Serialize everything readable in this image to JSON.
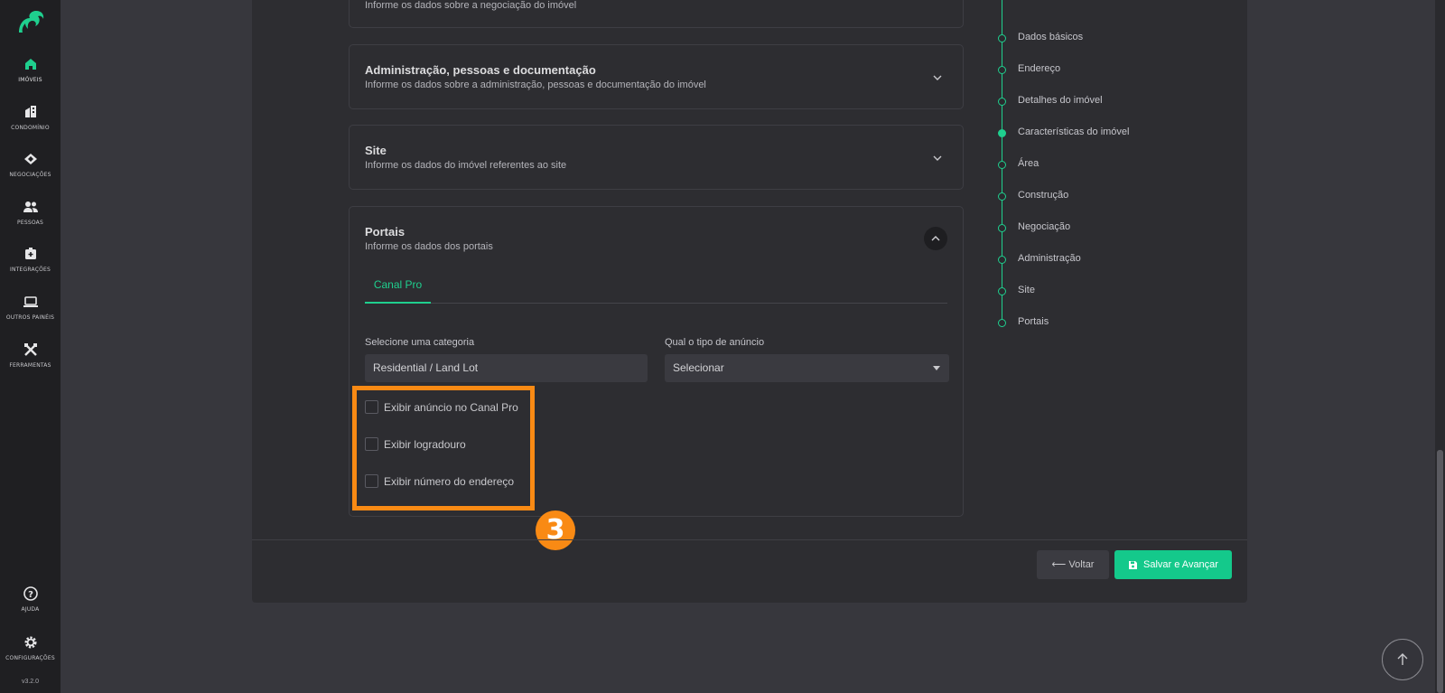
{
  "sidebar": {
    "items": [
      {
        "label": "Imóveis",
        "icon": "home-icon"
      },
      {
        "label": "Condomínio",
        "icon": "building-icon"
      },
      {
        "label": "Negociações",
        "icon": "handshake-icon"
      },
      {
        "label": "Pessoas",
        "icon": "people-icon"
      },
      {
        "label": "Integrações",
        "icon": "integration-icon"
      },
      {
        "label": "Outros painéis",
        "icon": "laptop-icon"
      },
      {
        "label": "Ferramentas",
        "icon": "tools-icon"
      },
      {
        "label": "Ajuda",
        "icon": "help-icon"
      },
      {
        "label": "Configurações",
        "icon": "gear-icon"
      }
    ],
    "version": "v3.2.0"
  },
  "sections": {
    "negociacao_sub": "Informe os dados sobre a negociação do imóvel",
    "administracao": {
      "title": "Administração, pessoas e documentação",
      "subtitle": "Informe os dados sobre a administração, pessoas e documentação do imóvel"
    },
    "site": {
      "title": "Site",
      "subtitle": "Informe os dados do imóvel referentes ao site"
    },
    "portais": {
      "title": "Portais",
      "subtitle": "Informe os dados dos portais",
      "tab": "Canal Pro",
      "category_label": "Selecione uma categoria",
      "category_value": "Residential / Land Lot",
      "ad_type_label": "Qual o tipo de anúncio",
      "ad_type_value": "Selecionar",
      "checkboxes": [
        "Exibir anúncio no Canal Pro",
        "Exibir logradouro",
        "Exibir número do endereço"
      ]
    }
  },
  "annotation": {
    "step": "3",
    "color": "#f98a14"
  },
  "footer": {
    "back_label": "Voltar",
    "save_label": "Salvar e Avançar"
  },
  "timeline": {
    "items": [
      "Dados básicos",
      "Endereço",
      "Detalhes do imóvel",
      "Características do imóvel",
      "Área",
      "Construção",
      "Negociação",
      "Administração",
      "Site",
      "Portais"
    ],
    "active_index": 3
  },
  "colors": {
    "accent": "#1fcf8e",
    "background": "#37373d",
    "card": "#2d2d31"
  }
}
